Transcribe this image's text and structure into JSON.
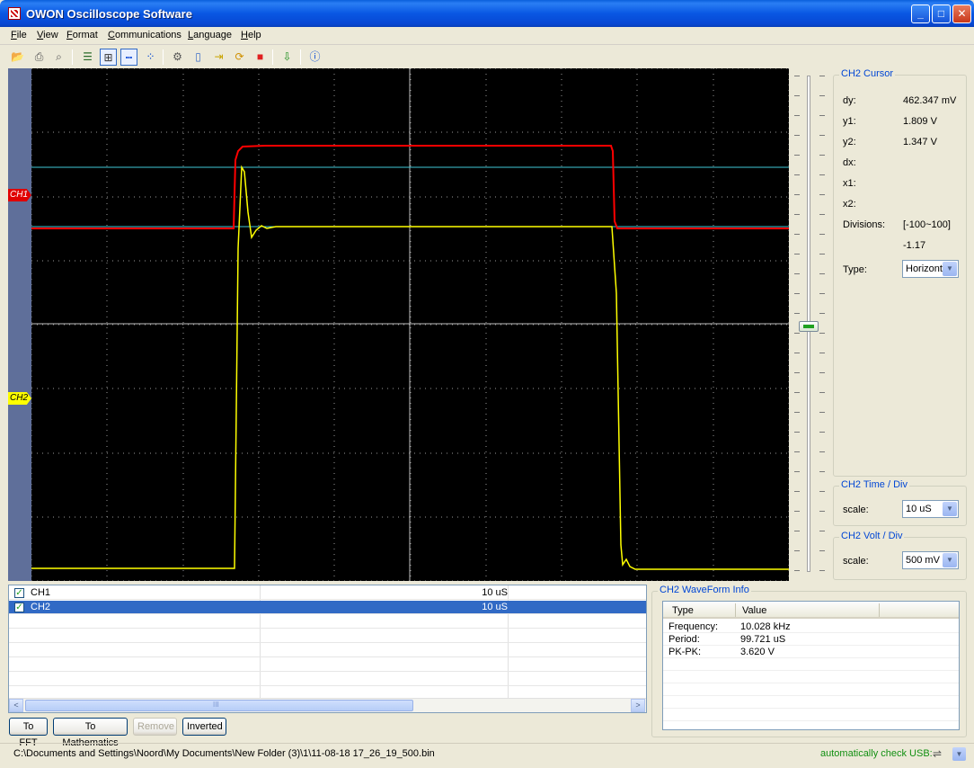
{
  "window": {
    "title": "OWON Oscilloscope Software",
    "min": "_",
    "max": "□",
    "close": "✕"
  },
  "menu": [
    "File",
    "View",
    "Format",
    "Communications",
    "Language",
    "Help"
  ],
  "toolbar": {
    "icons": [
      "open-folder-icon",
      "print-icon",
      "print-preview-icon",
      "list-icon",
      "grid-icon",
      "dots-line-icon",
      "dots-icon",
      "settings-icon",
      "battery-icon",
      "export-icon",
      "refresh-icon",
      "stop-icon",
      "download-icon",
      "help-icon"
    ]
  },
  "scope": {
    "markers": {
      "ch1": "CH1",
      "ch2": "CH2"
    },
    "colors": {
      "ch1": "#ff0000",
      "ch2": "#ffff00",
      "cursor": "#40c8d8",
      "background": "#000000",
      "grid": "#9a9a9a"
    }
  },
  "cursor_panel": {
    "title": "CH2 Cursor",
    "rows": [
      {
        "label": "dy:",
        "value": "462.347 mV"
      },
      {
        "label": "y1:",
        "value": "1.809 V"
      },
      {
        "label": "y2:",
        "value": "1.347 V"
      },
      {
        "label": "dx:",
        "value": ""
      },
      {
        "label": "x1:",
        "value": ""
      },
      {
        "label": "x2:",
        "value": ""
      },
      {
        "label": "Divisions:",
        "value": "[-100~100]"
      }
    ],
    "divisions_value": "-1.17",
    "type_label": "Type:",
    "type_value": "Horizont"
  },
  "time_div": {
    "title": "CH2 Time / Div",
    "label": "scale:",
    "value": "10 uS"
  },
  "volt_div": {
    "title": "CH2 Volt / Div",
    "label": "scale:",
    "value": "500 mV"
  },
  "channels": [
    {
      "name": "CH1",
      "timebase": "10 uS",
      "checked": "✓",
      "selected": false
    },
    {
      "name": "CH2",
      "timebase": "10 uS",
      "checked": "✓",
      "selected": true
    }
  ],
  "scrollbar": {
    "left": "<",
    "right": ">",
    "grip": "III"
  },
  "buttons": {
    "fft": "To FFT",
    "math": "To Mathematics",
    "remove": "Remove",
    "inverted": "Inverted"
  },
  "waveform_info": {
    "title": "CH2 WaveForm Info",
    "headers": [
      "Type",
      "Value"
    ],
    "rows": [
      {
        "type": "Frequency:",
        "value": "10.028 kHz"
      },
      {
        "type": "Period:",
        "value": "99.721 uS"
      },
      {
        "type": "PK-PK:",
        "value": "3.620 V"
      }
    ]
  },
  "status": {
    "path": "C:\\Documents and Settings\\Noord\\My Documents\\New Folder (3)\\1\\11-08-18 17_26_19_500.bin",
    "usb": "automatically check USB:"
  }
}
